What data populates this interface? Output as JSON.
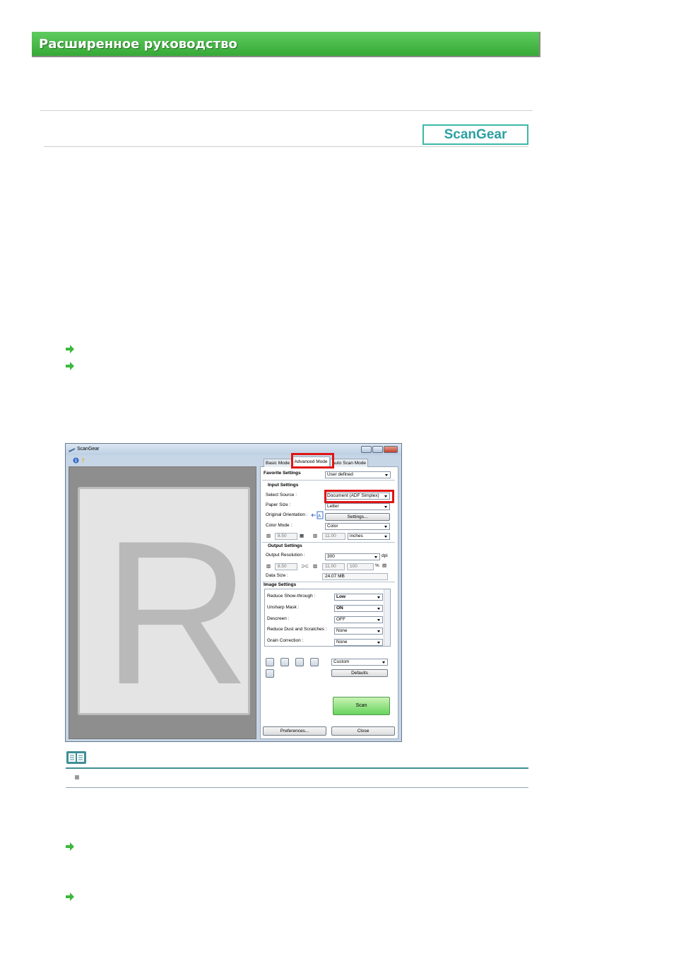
{
  "header": {
    "title": "Расширенное руководство"
  },
  "badge": {
    "label": "ScanGear"
  },
  "links": [
    {
      "icon": "arrow-right-icon"
    },
    {
      "icon": "arrow-right-icon"
    },
    {
      "icon": "arrow-right-icon"
    },
    {
      "icon": "arrow-right-icon"
    }
  ],
  "window": {
    "title": "ScanGear",
    "tabs": {
      "basic": "Basic Mode",
      "advanced": "Advanced Mode",
      "auto": "Auto Scan Mode"
    },
    "favorite": {
      "label": "Favorite Settings",
      "value": "User defined"
    },
    "input": {
      "heading": "Input Settings",
      "select_source_label": "Select Source :",
      "select_source_value": "Document (ADF Simplex)",
      "paper_size_label": "Paper Size :",
      "paper_size_value": "Letter",
      "orientation_label": "Original Orientation :",
      "settings_button": "Settings...",
      "color_mode_label": "Color Mode :",
      "color_mode_value": "Color",
      "width_value": "8.50",
      "height_value": "11.00",
      "unit_value": "inches"
    },
    "output": {
      "heading": "Output Settings",
      "resolution_label": "Output Resolution :",
      "resolution_value": "300",
      "resolution_unit": "dpi",
      "width_value": "8.50",
      "height_value": "11.00",
      "scale_value": "100",
      "scale_unit": "%",
      "data_size_label": "Data Size :",
      "data_size_value": "24.07 MB"
    },
    "image": {
      "heading": "Image Settings",
      "rows": [
        {
          "label": "Reduce Show-through :",
          "value": "Low"
        },
        {
          "label": "Unsharp Mask :",
          "value": "ON"
        },
        {
          "label": "Descreen :",
          "value": "OFF"
        },
        {
          "label": "Reduce Dust and Scratches :",
          "value": "None"
        },
        {
          "label": "Grain Correction :",
          "value": "None"
        }
      ]
    },
    "tone": {
      "preset_value": "Custom",
      "defaults_button": "Defaults"
    },
    "scan_button": "Scan",
    "preferences_button": "Preferences...",
    "close_button": "Close",
    "preview_letter": "R"
  },
  "note": {
    "icon": "book-icon"
  },
  "colors": {
    "banner": "#3fb53f",
    "badge": "#2c9fa0",
    "highlight": "#e01414",
    "scan": "#67d35c"
  }
}
